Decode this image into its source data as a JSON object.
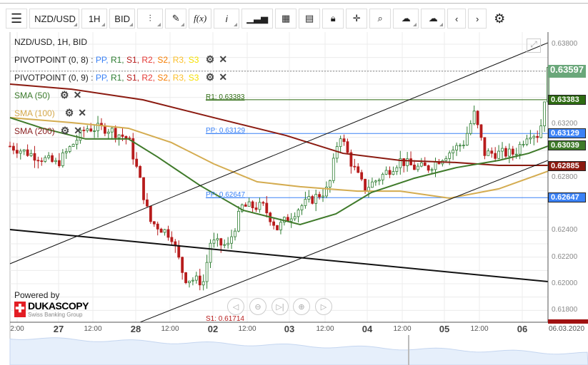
{
  "toolbar": {
    "symbol": "NZD/USD",
    "timeframe": "1H",
    "side": "BID",
    "fx": "f(x)",
    "info": "i"
  },
  "legend": {
    "title": "NZD/USD, 1H, BID",
    "pivot1": "PIVOTPOINT (0, 8)",
    "pivot2": "PIVOTPOINT (0, 9)",
    "pivot_parts": [
      ":",
      "PP,",
      "R1,",
      "S1,",
      "R2,",
      "S2,",
      "R3,",
      "S3"
    ],
    "pivot_colors": [
      "#444",
      "#3b82f6",
      "#2e7d32",
      "#b71c1c",
      "#e53935",
      "#f57c00",
      "#fbc02d",
      "#f5e000"
    ],
    "sma50": "SMA (50)",
    "sma100": "SMA (100)",
    "sma200": "SMA (200)"
  },
  "pivots": {
    "r1": "R1: 0.63383",
    "pp": "PP: 0.63129",
    "pp2": "PP: 0.62647",
    "s1": "S1: 0.61714"
  },
  "price_ticks": [
    "0.63800",
    "0.63200",
    "0.62800",
    "0.62400",
    "0.62200",
    "0.62000",
    "0.61800"
  ],
  "price_tick_values": [
    0.638,
    0.632,
    0.628,
    0.624,
    0.622,
    0.62,
    0.618
  ],
  "price_badges": [
    {
      "label": "0.63597",
      "value": 0.63597,
      "color": "#6aa77a"
    },
    {
      "label": "0.63383",
      "value": 0.63383,
      "color": "#2e6b12"
    },
    {
      "label": "0.63129",
      "value": 0.63129,
      "color": "#3b82f6"
    },
    {
      "label": "0.63039",
      "value": 0.63039,
      "color": "#3f7a2a"
    },
    {
      "label": "0.62885",
      "value": 0.62885,
      "color": "#8b1a10"
    },
    {
      "label": "0.62647",
      "value": 0.62647,
      "color": "#3b82f6"
    }
  ],
  "time_labels": [
    {
      "t": "2:00",
      "day": false
    },
    {
      "t": "27",
      "day": true
    },
    {
      "t": "12:00",
      "day": false
    },
    {
      "t": "28",
      "day": true
    },
    {
      "t": "12:00",
      "day": false
    },
    {
      "t": "02",
      "day": true
    },
    {
      "t": "12:00",
      "day": false
    },
    {
      "t": "03",
      "day": true
    },
    {
      "t": "12:00",
      "day": false
    },
    {
      "t": "04",
      "day": true
    },
    {
      "t": "12:00",
      "day": false
    },
    {
      "t": "05",
      "day": true
    },
    {
      "t": "12:00",
      "day": false
    },
    {
      "t": "06",
      "day": true
    },
    {
      "t": "06.03.2020",
      "day": false
    }
  ],
  "branding": {
    "powered": "Powered by",
    "name": "DUKASCOPY",
    "sub": "Swiss Banking Group"
  },
  "price_path": [
    [
      0,
      0.63034
    ],
    [
      13.4,
      0.629
    ],
    [
      21.5,
      0.63168
    ],
    [
      27.6,
      0.63168
    ],
    [
      33.7,
      0.63088
    ],
    [
      36.8,
      0.62793
    ],
    [
      39.8,
      0.62471
    ],
    [
      45.9,
      0.62364
    ],
    [
      49.6,
      0.62043
    ],
    [
      55,
      0.62016
    ],
    [
      57,
      0.62311
    ],
    [
      62,
      0.62284
    ],
    [
      66,
      0.62579
    ],
    [
      72,
      0.62579
    ],
    [
      76,
      0.62418
    ],
    [
      82.5,
      0.62579
    ],
    [
      90.6,
      0.62713
    ],
    [
      93.7,
      0.63141
    ],
    [
      96.7,
      0.62927
    ],
    [
      100.8,
      0.62713
    ],
    [
      104.9,
      0.62793
    ],
    [
      111,
      0.62927
    ],
    [
      115,
      0.62873
    ],
    [
      119,
      0.62873
    ],
    [
      123,
      0.62954
    ],
    [
      129,
      0.63061
    ],
    [
      132,
      0.63275
    ],
    [
      135,
      0.6298
    ],
    [
      139,
      0.6298
    ],
    [
      143.5,
      0.6298
    ],
    [
      147.5,
      0.63141
    ],
    [
      150.6,
      0.63114
    ],
    [
      153,
      0.63597
    ]
  ],
  "sma200": [
    [
      0,
      0.635
    ],
    [
      17.5,
      0.63462
    ],
    [
      37.8,
      0.63382
    ],
    [
      58,
      0.63248
    ],
    [
      78.5,
      0.63114
    ],
    [
      94.7,
      0.6298
    ],
    [
      111,
      0.62927
    ],
    [
      127,
      0.62911
    ],
    [
      139,
      0.62889
    ],
    [
      153,
      0.62889
    ]
  ],
  "sma100": [
    [
      0,
      0.63248
    ],
    [
      17.5,
      0.63211
    ],
    [
      33.7,
      0.63168
    ],
    [
      45.9,
      0.63061
    ],
    [
      58,
      0.629
    ],
    [
      70.3,
      0.62766
    ],
    [
      82.5,
      0.62729
    ],
    [
      98.8,
      0.62696
    ],
    [
      111,
      0.62696
    ],
    [
      125,
      0.62643
    ],
    [
      139,
      0.62713
    ],
    [
      153,
      0.62846
    ]
  ],
  "sma50": [
    [
      0,
      0.63248
    ],
    [
      9.3,
      0.63168
    ],
    [
      21.5,
      0.63088
    ],
    [
      33.7,
      0.63088
    ],
    [
      41.9,
      0.62954
    ],
    [
      54,
      0.62739
    ],
    [
      66.3,
      0.62552
    ],
    [
      82.5,
      0.62445
    ],
    [
      92.7,
      0.62525
    ],
    [
      102.8,
      0.62686
    ],
    [
      115,
      0.62793
    ],
    [
      127,
      0.62873
    ],
    [
      139,
      0.62927
    ],
    [
      147.5,
      0.6298
    ],
    [
      153,
      0.63034
    ]
  ],
  "trendlines": [
    [
      [
        0,
        0.6215
      ],
      [
        153,
        0.63811
      ]
    ],
    [
      [
        37,
        0.61711
      ],
      [
        153,
        0.62927
      ]
    ],
    [
      [
        0,
        0.62407
      ],
      [
        153,
        0.62016
      ]
    ]
  ],
  "pivot_levels": {
    "r1": 0.63383,
    "pp": 0.63129,
    "pp2": 0.62647,
    "s1": 0.61714,
    "last": 0.63597
  }
}
